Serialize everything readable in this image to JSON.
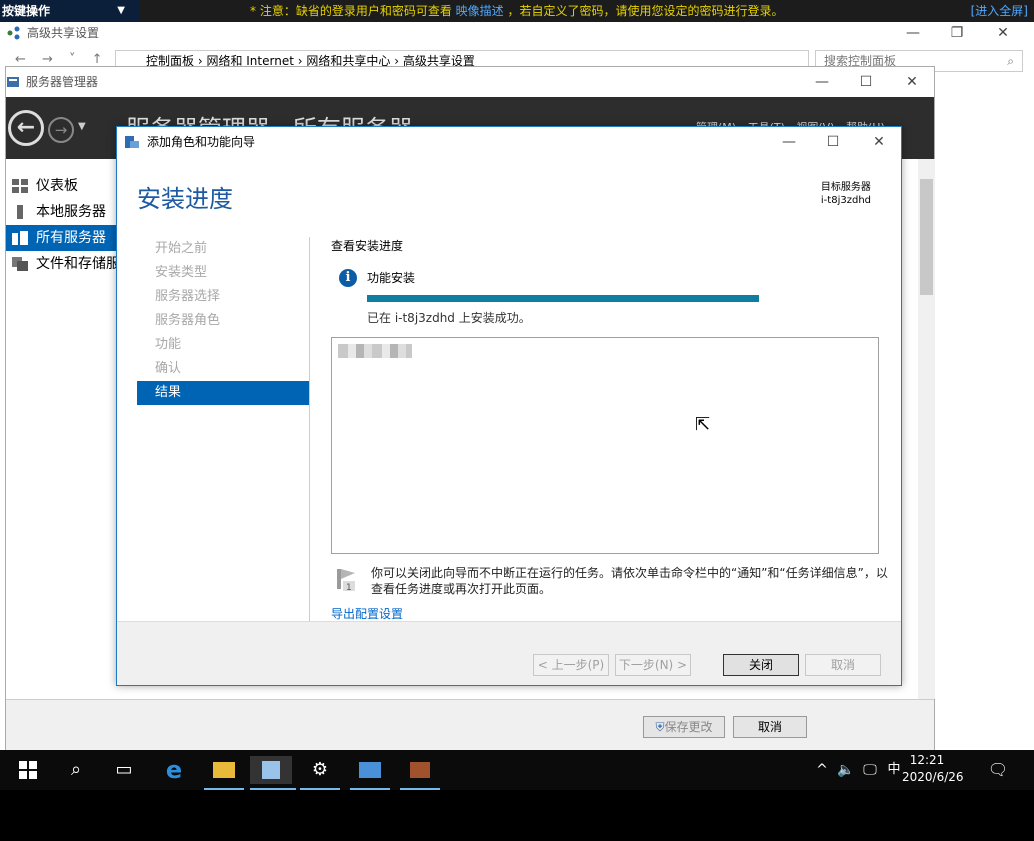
{
  "notice_bar": {
    "kbd_label": "按键操作",
    "notice_prefix": "* 注意：缺省的登录用户和密码可查看",
    "notice_link": "映像描述",
    "notice_suffix": "，若自定义了密码，请使用您设定的密码进行登录。",
    "fullscreen": "[进入全屏]"
  },
  "control_panel": {
    "title": "高级共享设置",
    "breadcrumb": [
      "控制面板",
      "网络和 Internet",
      "网络和共享中心",
      "高级共享设置"
    ],
    "search_placeholder": "搜索控制面板"
  },
  "server_manager": {
    "title": "服务器管理器",
    "header_title": "服务器管理器 · 所有服务器",
    "menus": "管理(M) 工具(T) 视图(V) 帮助(H)",
    "nav": [
      {
        "label": "仪表板",
        "icon": "dashboard-icon"
      },
      {
        "label": "本地服务器",
        "icon": "local-server-icon"
      },
      {
        "label": "所有服务器",
        "icon": "all-servers-icon"
      },
      {
        "label": "文件和存储服务",
        "icon": "storage-icon"
      }
    ],
    "save_button": "保存更改",
    "cancel_button": "取消"
  },
  "wizard": {
    "title": "添加角色和功能向导",
    "heading": "安装进度",
    "target_label": "目标服务器",
    "target_server": "i-t8j3zdhd",
    "steps": [
      "开始之前",
      "安装类型",
      "服务器选择",
      "服务器角色",
      "功能",
      "确认",
      "结果"
    ],
    "active_step": 6,
    "section_label": "查看安装进度",
    "feature_label": "功能安装",
    "progress": 1.0,
    "success_text": "已在 i-t8j3zdhd 上安装成功。",
    "note_text": "你可以关闭此向导而不中断正在运行的任务。请依次单击命令栏中的“通知”和“任务详细信息”，以查看任务进度或再次打开此页面。",
    "export_link": "导出配置设置",
    "buttons": {
      "prev": "< 上一步(P)",
      "next": "下一步(N) >",
      "close": "关闭",
      "cancel": "取消"
    }
  },
  "taskbar": {
    "time": "12:21",
    "date": "2020/6/26",
    "ime": "中",
    "accent": "#76b9ed"
  }
}
